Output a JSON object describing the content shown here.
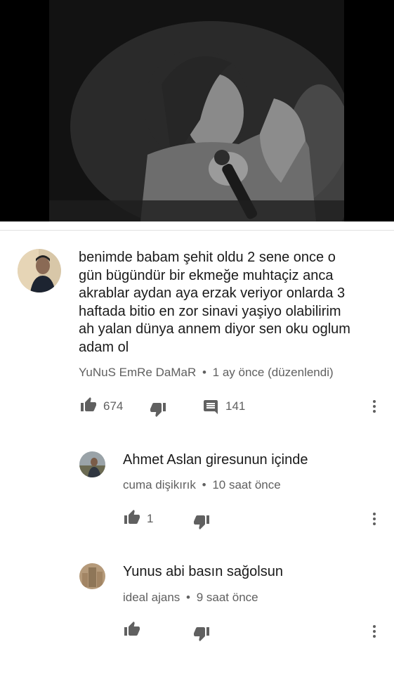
{
  "comment": {
    "text_lines": [
      "benimde babam şehit oldu 2 sene once o",
      "gün bügündür bir ekmeğe muhtaçiz anca",
      "akrablar aydan aya erzak veriyor onlarda 3",
      "haftada bitio en zor sinavi yaşiyo olabilirim",
      "ah yalan dünya annem diyor sen oku oglum",
      "adam ol"
    ],
    "author": "YuNuS EmRe DaMaR",
    "time": "1 ay önce (düzenlendi)",
    "likes": "674",
    "replies": "141"
  },
  "replies": [
    {
      "text": "Ahmet Aslan giresunun içinde",
      "author": "cuma dişikırık",
      "time": "10 saat önce",
      "likes": "1"
    },
    {
      "text": "Yunus abi basın sağolsun",
      "author": "ideal ajans",
      "time": "9 saat önce",
      "likes": ""
    }
  ],
  "separator": "•",
  "icons": {
    "like": "thumb-up-icon",
    "dislike": "thumb-down-icon",
    "reply": "comment-icon",
    "menu": "more-vert-icon"
  }
}
